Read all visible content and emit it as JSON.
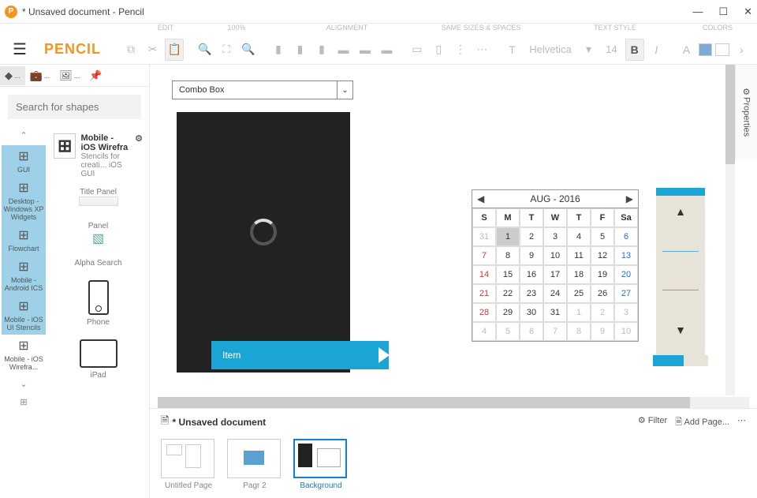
{
  "window": {
    "title": "* Unsaved document - Pencil",
    "app_icon_letter": "P"
  },
  "logo": "PENCIL",
  "toolbar_labels": {
    "edit": "EDIT",
    "zoom": "100%",
    "alignment": "ALIGNMENT",
    "sizes": "SAME SIZES & SPACES",
    "text": "TEXT STYLE",
    "colors": "COLORS"
  },
  "toolbar": {
    "font_name": "Helvetica",
    "font_size": "14",
    "zoom": "100%"
  },
  "search": {
    "placeholder": "Search for shapes"
  },
  "categories": [
    {
      "label": "GUI",
      "selected": true
    },
    {
      "label": "Desktop - Windows XP Widgets",
      "selected": true
    },
    {
      "label": "Flowchart",
      "selected": true
    },
    {
      "label": "Mobile - Android ICS",
      "selected": true
    },
    {
      "label": "Mobile - iOS UI Stencils",
      "selected": true
    },
    {
      "label": "Mobile - iOS Wirefra...",
      "selected": false
    }
  ],
  "stencil_header": {
    "title": "Mobile - iOS Wirefra",
    "desc": "Stencils for creati... iOS GUI"
  },
  "shapes": [
    {
      "label": "Title Panel"
    },
    {
      "label": "Panel"
    },
    {
      "label": "Alpha Search"
    },
    {
      "label": "Phone"
    },
    {
      "label": "iPad"
    }
  ],
  "canvas": {
    "combobox_label": "Combo Box",
    "tag_label": "Item"
  },
  "calendar": {
    "title": "AUG - 2016",
    "days": [
      "S",
      "M",
      "T",
      "W",
      "T",
      "F",
      "Sa"
    ],
    "rows": [
      [
        {
          "v": "31",
          "dim": true,
          "sun": true
        },
        {
          "v": "1",
          "sel": true
        },
        {
          "v": "2"
        },
        {
          "v": "3"
        },
        {
          "v": "4"
        },
        {
          "v": "5"
        },
        {
          "v": "6",
          "sat": true
        }
      ],
      [
        {
          "v": "7",
          "sun": true
        },
        {
          "v": "8"
        },
        {
          "v": "9"
        },
        {
          "v": "10"
        },
        {
          "v": "11"
        },
        {
          "v": "12"
        },
        {
          "v": "13",
          "sat": true
        }
      ],
      [
        {
          "v": "14",
          "sun": true
        },
        {
          "v": "15"
        },
        {
          "v": "16"
        },
        {
          "v": "17"
        },
        {
          "v": "18"
        },
        {
          "v": "19"
        },
        {
          "v": "20",
          "sat": true
        }
      ],
      [
        {
          "v": "21",
          "sun": true
        },
        {
          "v": "22"
        },
        {
          "v": "23"
        },
        {
          "v": "24"
        },
        {
          "v": "25"
        },
        {
          "v": "26"
        },
        {
          "v": "27",
          "sat": true
        }
      ],
      [
        {
          "v": "28",
          "sun": true
        },
        {
          "v": "29"
        },
        {
          "v": "30"
        },
        {
          "v": "31"
        },
        {
          "v": "1",
          "dim": true
        },
        {
          "v": "2",
          "dim": true
        },
        {
          "v": "3",
          "dim": true
        }
      ],
      [
        {
          "v": "4",
          "dim": true,
          "sun": true
        },
        {
          "v": "5",
          "dim": true
        },
        {
          "v": "6",
          "dim": true
        },
        {
          "v": "7",
          "dim": true
        },
        {
          "v": "8",
          "dim": true
        },
        {
          "v": "9",
          "dim": true
        },
        {
          "v": "10",
          "dim": true
        }
      ]
    ]
  },
  "pagebar": {
    "doc_label": "* Unsaved document",
    "filter_label": "Filter",
    "add_page_label": "Add Page...",
    "pages": [
      {
        "label": "Untitled Page",
        "active": false
      },
      {
        "label": "Pagr 2",
        "active": false
      },
      {
        "label": "Background",
        "active": true
      }
    ]
  },
  "properties_tab": "Properties"
}
